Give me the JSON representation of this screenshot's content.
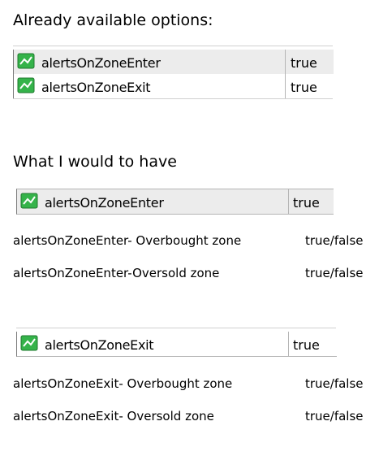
{
  "existing": {
    "heading": "Already available options:",
    "rows": [
      {
        "name": "alertsOnZoneEnter",
        "value": "true"
      },
      {
        "name": "alertsOnZoneExit",
        "value": "true"
      }
    ]
  },
  "desired": {
    "heading": "What I would to have",
    "enter_row": {
      "name": "alertsOnZoneEnter",
      "value": "true"
    },
    "enter_options": [
      {
        "label": "alertsOnZoneEnter- Overbought zone",
        "value": "true/false"
      },
      {
        "label": "alertsOnZoneEnter-Oversold zone",
        "value": "true/false"
      }
    ],
    "exit_row": {
      "name": "alertsOnZoneExit",
      "value": "true"
    },
    "exit_options": [
      {
        "label": "alertsOnZoneExit- Overbought zone",
        "value": "true/false"
      },
      {
        "label": "alertsOnZoneExit- Oversold zone",
        "value": "true/false"
      }
    ]
  },
  "icons": {
    "param_icon": "input-parameter-icon"
  },
  "colors": {
    "icon_green": "#35b34a",
    "row_highlight": "#ececec",
    "grid_line": "#b5b5b5"
  }
}
